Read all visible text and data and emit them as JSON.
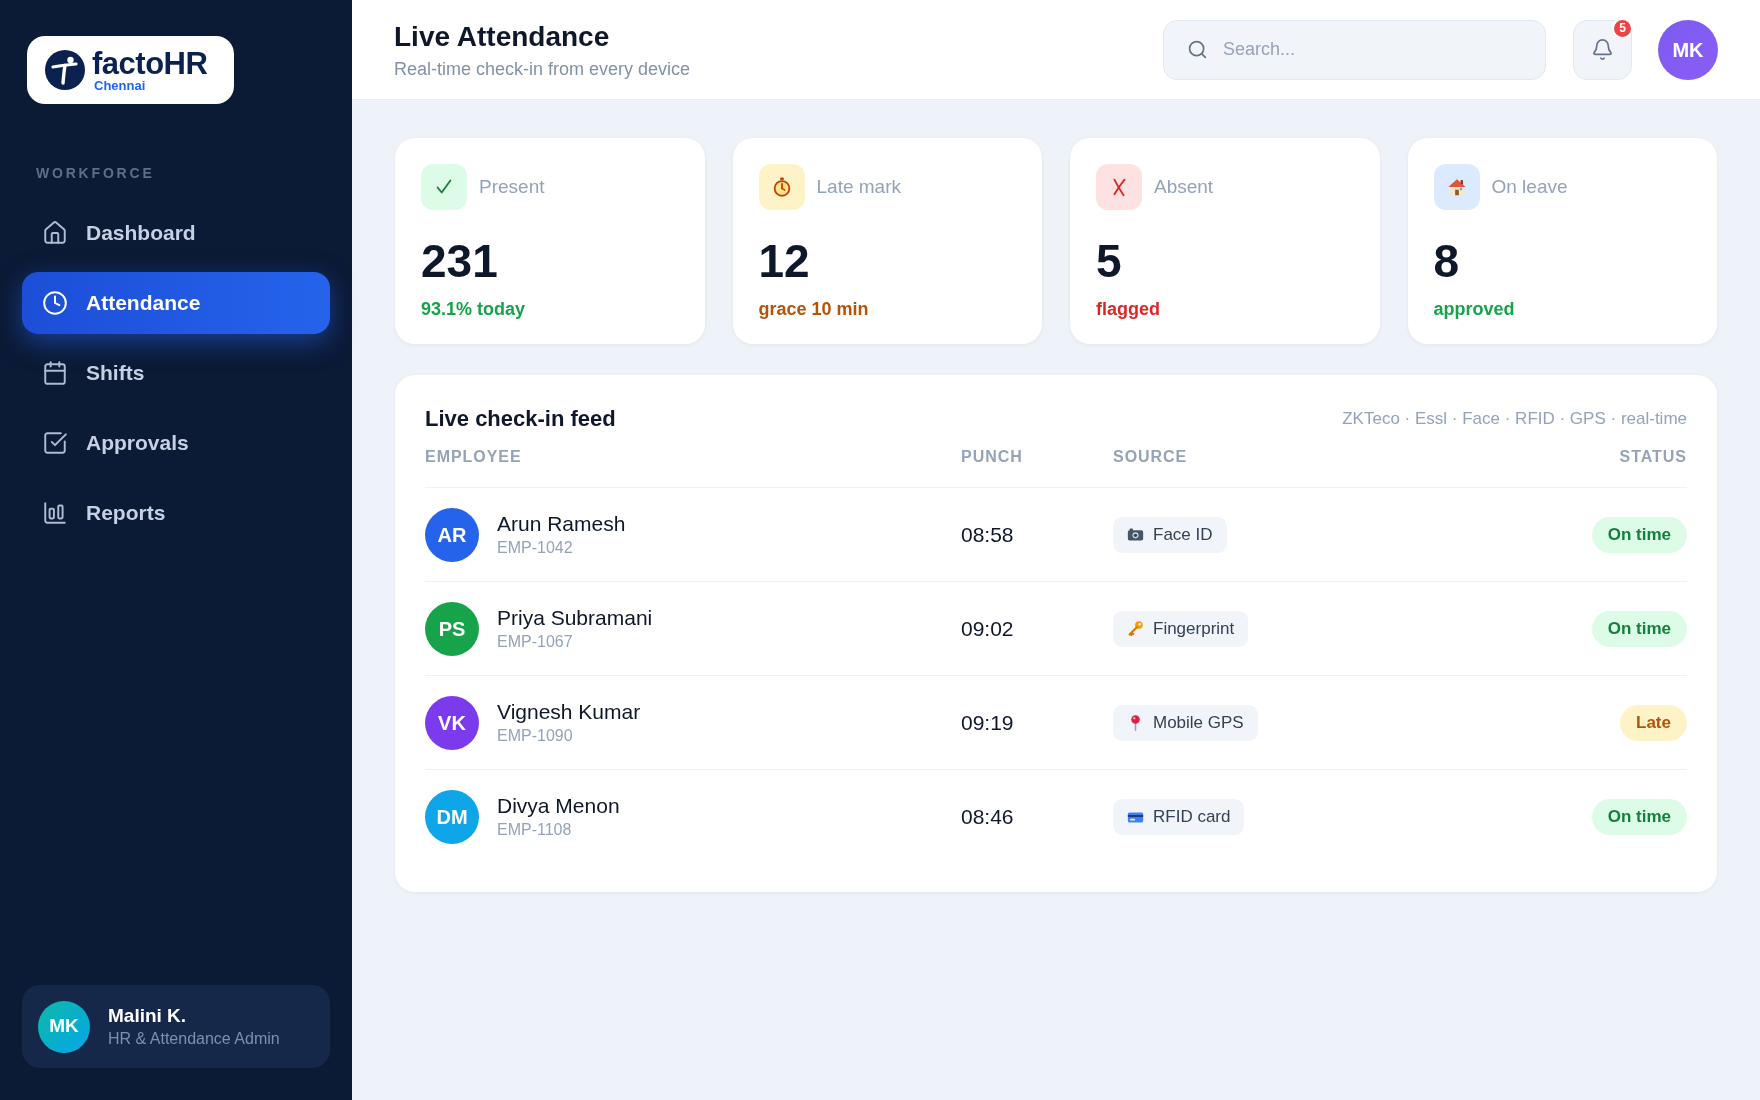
{
  "sidebar": {
    "logo": {
      "name": "factoHR",
      "location": "Chennai"
    },
    "section_label": "WORKFORCE",
    "items": [
      {
        "label": "Dashboard",
        "selected": false
      },
      {
        "label": "Attendance",
        "selected": true
      },
      {
        "label": "Shifts",
        "selected": false
      },
      {
        "label": "Approvals",
        "selected": false
      },
      {
        "label": "Reports",
        "selected": false
      }
    ],
    "user": {
      "initials": "MK",
      "name": "Malini K.",
      "role": "HR & Attendance Admin"
    }
  },
  "header": {
    "title": "Live Attendance",
    "subtitle": "Real-time check-in from every device",
    "search": {
      "placeholder": "Search..."
    },
    "notifications": {
      "count": "5"
    },
    "avatar": {
      "initials": "MK"
    }
  },
  "stats": [
    {
      "kind": "present",
      "label": "Present",
      "value": "231",
      "note": "93.1% today"
    },
    {
      "kind": "late",
      "label": "Late mark",
      "value": "12",
      "note": "grace 10 min"
    },
    {
      "kind": "absent",
      "label": "Absent",
      "value": "5",
      "note": "flagged"
    },
    {
      "kind": "leave",
      "label": "On leave",
      "value": "8",
      "note": "approved"
    }
  ],
  "feed": {
    "title": "Live check-in feed",
    "sources_caption": "ZKTeco · Essl · Face · RFID · GPS · real-time",
    "columns": [
      "EMPLOYEE",
      "PUNCH",
      "SOURCE",
      "STATUS"
    ],
    "rows": [
      {
        "initials": "AR",
        "name": "Arun Ramesh",
        "employee_id": "EMP-1042",
        "color": "#2563eb",
        "punch": "08:58",
        "source": {
          "kind": "face",
          "label": "Face ID"
        },
        "status": {
          "kind": "ontime",
          "label": "On time"
        }
      },
      {
        "initials": "PS",
        "name": "Priya Subramani",
        "employee_id": "EMP-1067",
        "color": "#16a34a",
        "punch": "09:02",
        "source": {
          "kind": "fingerprint",
          "label": "Fingerprint"
        },
        "status": {
          "kind": "ontime",
          "label": "On time"
        }
      },
      {
        "initials": "VK",
        "name": "Vignesh Kumar",
        "employee_id": "EMP-1090",
        "color": "#7c3aed",
        "punch": "09:19",
        "source": {
          "kind": "gps",
          "label": "Mobile GPS"
        },
        "status": {
          "kind": "late",
          "label": "Late"
        }
      },
      {
        "initials": "DM",
        "name": "Divya Menon",
        "employee_id": "EMP-1108",
        "color": "#0ea5e9",
        "punch": "08:46",
        "source": {
          "kind": "rfid",
          "label": "RFID card"
        },
        "status": {
          "kind": "ontime",
          "label": "On time"
        }
      }
    ]
  }
}
